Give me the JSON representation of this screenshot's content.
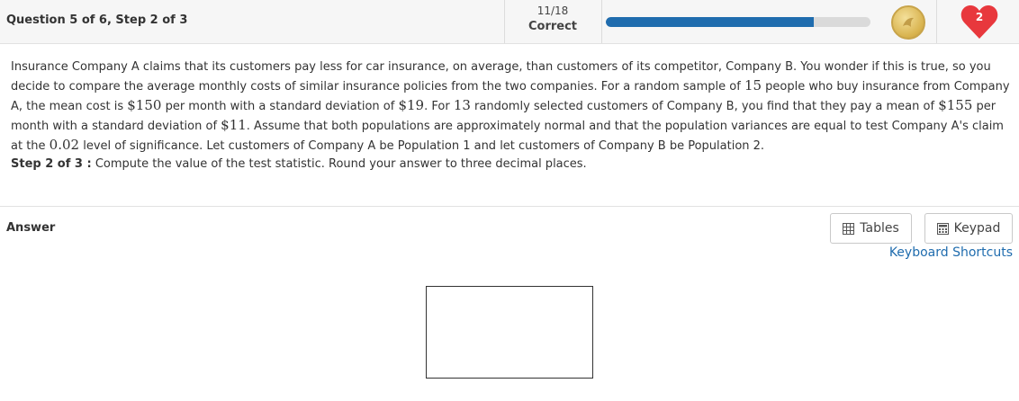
{
  "header": {
    "question_label": "Question 5 of 6, Step 2 of 3",
    "score_fraction": "11/18",
    "score_status": "Correct",
    "progress_fraction": 0.787,
    "hearts_count": "2",
    "colors": {
      "progress": "#1f6cae",
      "heart": "#e8383d",
      "coin": "#d8b24d"
    }
  },
  "question": {
    "p1": "Insurance Company A claims that its customers pay less for car insurance, on average, than customers of its competitor, Company B. You wonder if this is true, so you decide to compare the average monthly costs of similar insurance policies from the two companies. For a random sample of ",
    "n1": "15",
    "p2": " people who buy insurance from Company A, the mean cost is ",
    "mean1": "$150",
    "p3": " per month with a standard deviation of ",
    "sd1": "$19",
    "p4": ". For ",
    "n2": "13",
    "p5": " randomly selected customers of Company B, you find that they pay a mean of ",
    "mean2": "$155",
    "p6": " per month with a standard deviation of ",
    "sd2": "$11",
    "p7": ". Assume that both populations are approximately normal and that the population variances are equal to test Company A's claim at the ",
    "alpha": "0.02",
    "p8": " level of significance. Let customers of Company A be Population 1 and let customers of Company B be Population 2."
  },
  "step": {
    "label": "Step 2 of 3 :",
    "text": " Compute the value of the test statistic. Round your answer to three decimal places."
  },
  "answer": {
    "label": "Answer",
    "tables_label": "Tables",
    "keypad_label": "Keypad",
    "shortcuts_label": "Keyboard Shortcuts",
    "input_value": ""
  },
  "icons": [
    "coin-icon",
    "heart-icon",
    "table-icon",
    "keypad-icon"
  ]
}
